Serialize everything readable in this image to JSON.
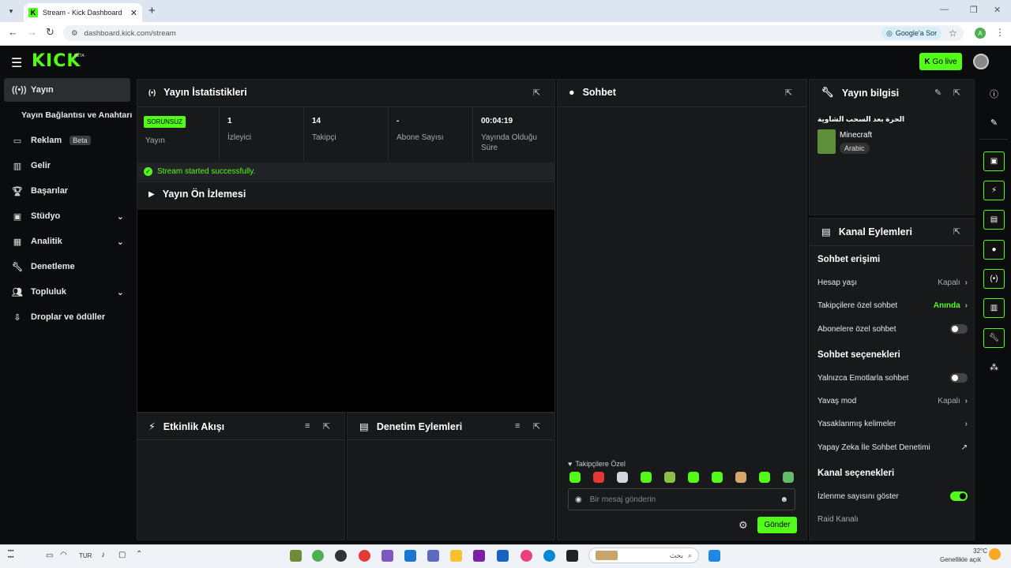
{
  "browser": {
    "tab_title": "Stream - Kick Dashboard",
    "url": "dashboard.kick.com/stream",
    "google_ask": "Google'a Sor",
    "profile_initial": "A"
  },
  "header": {
    "logo": "KICK",
    "logo_badge": "BETA",
    "go_live": "Go live"
  },
  "sidebar": {
    "items": [
      {
        "label": "Yayın",
        "icon": "broadcast-icon"
      },
      {
        "label": "Yayın Bağlantısı ve Anahtarı",
        "icon": "none"
      },
      {
        "label": "Reklam",
        "icon": "ad-icon",
        "badge": "Beta"
      },
      {
        "label": "Gelir",
        "icon": "chart-icon"
      },
      {
        "label": "Başarılar",
        "icon": "trophy-icon"
      },
      {
        "label": "Stüdyo",
        "icon": "studio-icon"
      },
      {
        "label": "Analitik",
        "icon": "analytics-icon"
      },
      {
        "label": "Denetleme",
        "icon": "wrench-icon"
      },
      {
        "label": "Topluluk",
        "icon": "community-icon"
      },
      {
        "label": "Droplar ve ödüller",
        "icon": "drops-icon"
      }
    ]
  },
  "stats": {
    "title": "Yayın İstatistikleri",
    "status_badge": "SORUNSUZ",
    "status_label": "Yayın",
    "viewers_value": "1",
    "viewers_label": "İzleyici",
    "followers_value": "14",
    "followers_label": "Takipçi",
    "subs_value": "-",
    "subs_label": "Abone Sayısı",
    "uptime_value": "00:04:19",
    "uptime_label": "Yayında Olduğu Süre",
    "success_message": "Stream started successfully."
  },
  "preview": {
    "title": "Yayın Ön İzlemesi"
  },
  "activity": {
    "title": "Etkinlik Akışı"
  },
  "moderation": {
    "title": "Denetim Eylemleri"
  },
  "chat": {
    "title": "Sohbet",
    "followers_only": "Takipçilere Özel",
    "placeholder": "Bir mesaj gönderin",
    "send": "Gönder"
  },
  "stream_info": {
    "title": "Yayın bilgisi",
    "stream_title": "الحرة بعد السحب الشاوية",
    "category": "Minecraft",
    "language": "Arabic"
  },
  "channel_actions": {
    "title": "Kanal Eylemleri",
    "chat_access": "Sohbet erişimi",
    "account_age": "Hesap yaşı",
    "account_age_value": "Kapalı",
    "followers_chat": "Takipçilere özel sohbet",
    "followers_chat_value": "Anında",
    "subs_chat": "Abonelere özel sohbet",
    "chat_options": "Sohbet seçenekleri",
    "emote_only": "Yalnızca Emotlarla sohbet",
    "slow_mode": "Yavaş mod",
    "slow_mode_value": "Kapalı",
    "banned_words": "Yasaklanmış kelimeler",
    "ai_moderation": "Yapay Zeka İle Sohbet Denetimi",
    "channel_options": "Kanal seçenekleri",
    "show_viewers": "İzlenme sayısını göster",
    "raid_channel": "Raid Kanalı"
  },
  "taskbar": {
    "lang": "TUR",
    "search_placeholder": "بحث",
    "temperature": "32°C",
    "weather": "Genellikle açık"
  },
  "colors": {
    "accent": "#53fc18",
    "panel": "#18191b",
    "background": "#0b0c0d"
  }
}
